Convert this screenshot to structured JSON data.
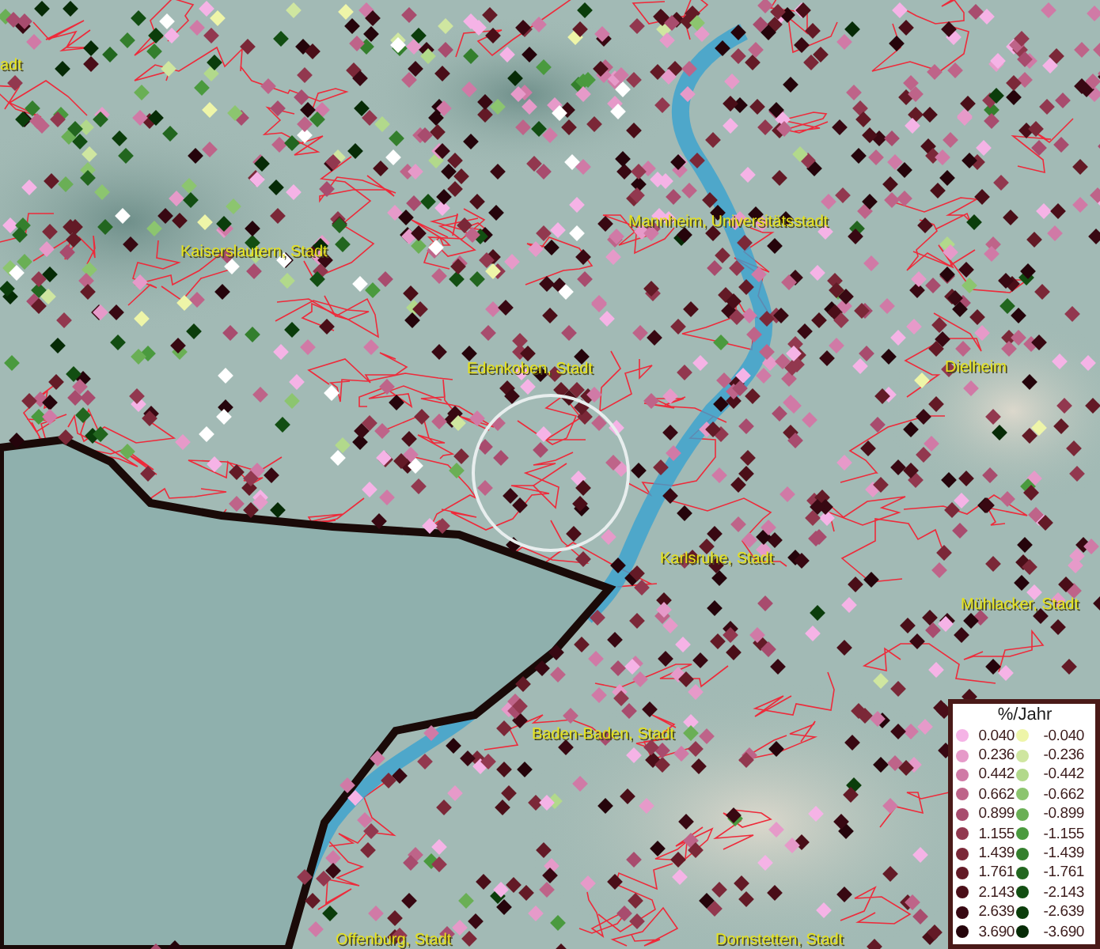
{
  "map": {
    "places": [
      {
        "name": "adt"
      },
      {
        "name": "Kaiserslautern, Stadt"
      },
      {
        "name": "Mannheim, Universitätsstadt"
      },
      {
        "name": "Edenkoben, Stadt"
      },
      {
        "name": "Dielheim"
      },
      {
        "name": "Karlsruhe, Stadt"
      },
      {
        "name": "Mühlacker, Stadt"
      },
      {
        "name": "Baden-Baden, Stadt"
      },
      {
        "name": "Offenburg, Stadt"
      },
      {
        "name": "Dornstetten, Stadt"
      }
    ]
  },
  "legend": {
    "title": "%/Jahr",
    "positive": [
      {
        "value": "0.040",
        "color": "#f5b3e6"
      },
      {
        "value": "0.236",
        "color": "#e69ac9"
      },
      {
        "value": "0.442",
        "color": "#d07aa6"
      },
      {
        "value": "0.662",
        "color": "#be6489"
      },
      {
        "value": "0.899",
        "color": "#a84c6e"
      },
      {
        "value": "1.155",
        "color": "#92384f"
      },
      {
        "value": "1.439",
        "color": "#7b2838"
      },
      {
        "value": "1.761",
        "color": "#631a26"
      },
      {
        "value": "2.143",
        "color": "#4a0e18"
      },
      {
        "value": "2.639",
        "color": "#380812"
      },
      {
        "value": "3.690",
        "color": "#25040b"
      }
    ],
    "negative": [
      {
        "value": "-0.040",
        "color": "#eef5a8"
      },
      {
        "value": "-0.236",
        "color": "#cfe6a0"
      },
      {
        "value": "-0.442",
        "color": "#b2d98b"
      },
      {
        "value": "-0.662",
        "color": "#8cc56f"
      },
      {
        "value": "-0.899",
        "color": "#6aaf55"
      },
      {
        "value": "-1.155",
        "color": "#4a9a3e"
      },
      {
        "value": "-1.439",
        "color": "#347f2d"
      },
      {
        "value": "-1.761",
        "color": "#22661f"
      },
      {
        "value": "-2.143",
        "color": "#124e12"
      },
      {
        "value": "-2.639",
        "color": "#0b3d0b"
      },
      {
        "value": "-3.690",
        "color": "#062b06"
      }
    ]
  }
}
